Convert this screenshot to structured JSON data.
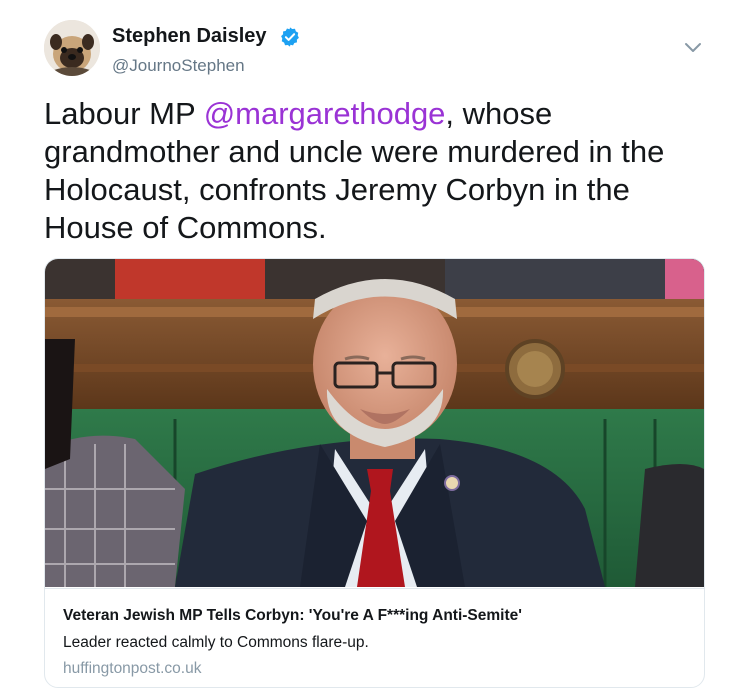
{
  "author": {
    "name": "Stephen Daisley",
    "handle": "@JournoStephen",
    "avatar_icon": "pug-avatar",
    "verified_icon": "verified-badge-icon"
  },
  "tweet": {
    "text_before": "Labour MP ",
    "mention": "@margarethodge",
    "text_after": ", whose grandmother and uncle were murdered in the Holocaust, confronts Jeremy Corbyn in the House of Commons."
  },
  "card": {
    "title": "Veteran Jewish MP Tells Corbyn: 'You're A F***ing Anti-Semite'",
    "description": "Leader reacted calmly to Commons flare-up.",
    "domain": "huffingtonpost.co.uk"
  },
  "colors": {
    "mention": "#9a33d5",
    "verified": "#1da1f2",
    "secondary_text": "#657786",
    "border": "#e1e8ed"
  }
}
